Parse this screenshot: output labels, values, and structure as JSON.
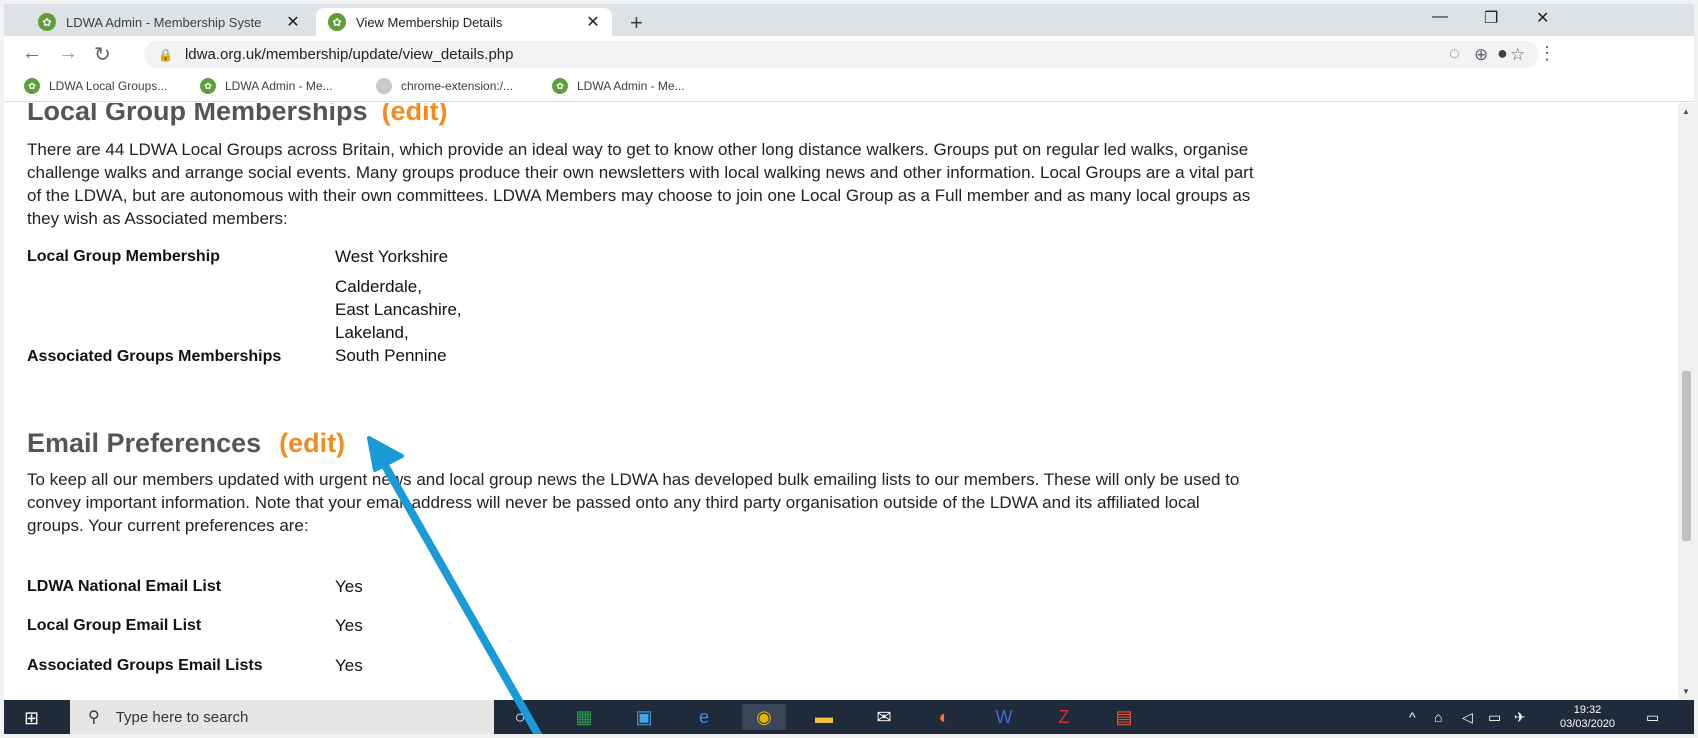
{
  "browser": {
    "tabs": [
      {
        "title": "LDWA Admin - Membership Syste",
        "close": "✕"
      },
      {
        "title": "View Membership Details",
        "close": "✕"
      }
    ],
    "new_tab": "+",
    "url": "ldwa.org.uk/membership/update/view_details.php",
    "bookmarks": [
      "LDWA Local Groups...",
      "LDWA Admin - Me...",
      "chrome-extension:/...",
      "LDWA Admin - Me..."
    ]
  },
  "local_groups": {
    "heading": "Local Group Memberships",
    "edit_label": "(edit)",
    "intro": "There are 44 LDWA Local Groups across Britain, which provide an ideal way to get to know other long distance walkers. Groups put on regular led walks, organise challenge walks and arrange social events. Many groups produce their own newsletters with local walking news and other information. Local Groups are a vital part of the LDWA, but are autonomous with their own committees. LDWA Members may choose to join one Local Group as a Full member and as many local groups as they wish as Associated members:",
    "membership_label": "Local Group Membership",
    "membership_value": "West Yorkshire",
    "associated_label": "Associated Groups Memberships",
    "associated_values": [
      "Calderdale,",
      "East Lancashire,",
      "Lakeland,",
      "South Pennine"
    ]
  },
  "email_prefs": {
    "heading": "Email Preferences",
    "edit_label": "(edit)",
    "intro": "To keep all our members updated with urgent news and local group news the LDWA has developed bulk emailing lists to our members. These will only be used to convey important information. Note that your email address will never be passed onto any third party organisation outside of the LDWA and its affiliated local groups. Your current preferences are:",
    "rows": [
      {
        "label": "LDWA National Email List",
        "value": "Yes"
      },
      {
        "label": "Local Group Email List",
        "value": "Yes"
      },
      {
        "label": "Associated Groups Email Lists",
        "value": "Yes"
      }
    ]
  },
  "taskbar": {
    "search_placeholder": "Type here to search",
    "time": "19:32",
    "date": "03/03/2020"
  },
  "colors": {
    "edit": "#f28c1e",
    "heading": "#555555",
    "arrow": "#1a9ad6"
  }
}
